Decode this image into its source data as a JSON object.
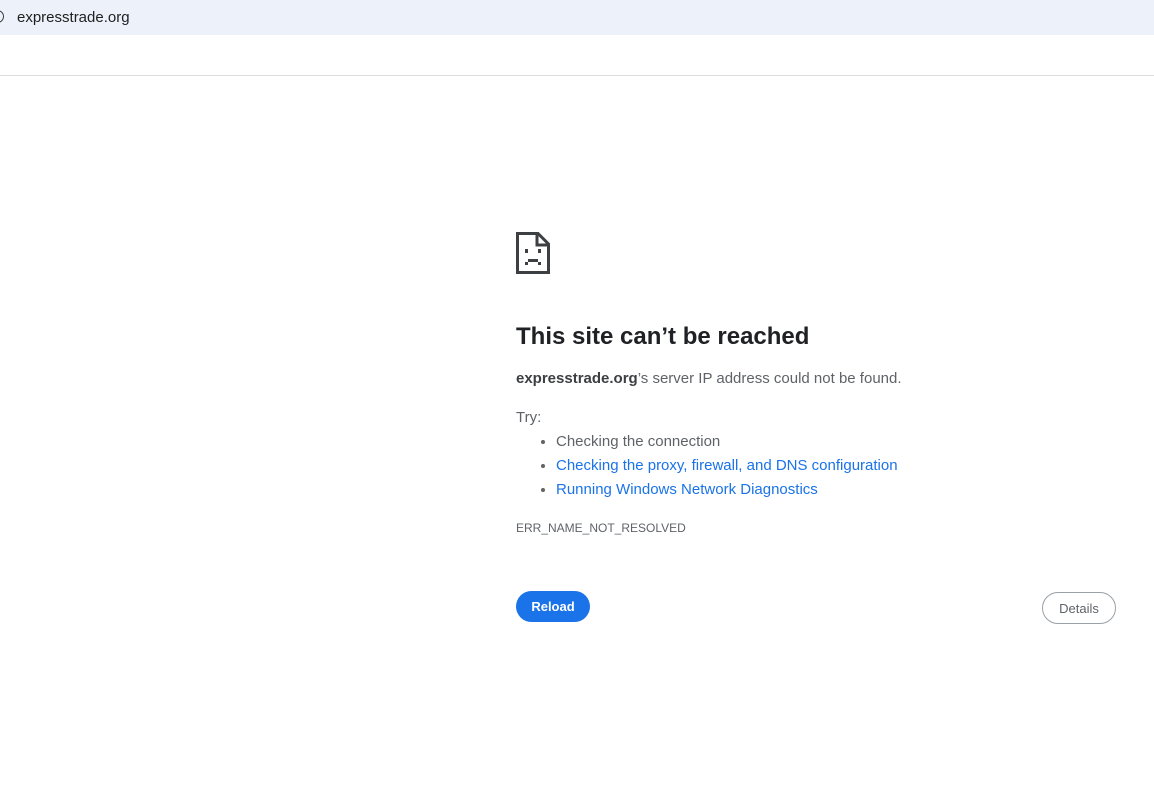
{
  "address_bar": {
    "url": "expresstrade.org",
    "icon": "site-info-icon"
  },
  "error": {
    "icon": "sad-page-icon",
    "title": "This site can’t be reached",
    "host": "expresstrade.org",
    "summary_suffix": "’s server IP address could not be found.",
    "try_label": "Try:",
    "suggestions": [
      {
        "label": "Checking the connection",
        "is_link": false
      },
      {
        "label": "Checking the proxy, firewall, and DNS configuration",
        "is_link": true
      },
      {
        "label": "Running Windows Network Diagnostics",
        "is_link": true
      }
    ],
    "code": "ERR_NAME_NOT_RESOLVED"
  },
  "buttons": {
    "reload_label": "Reload",
    "details_label": "Details"
  },
  "colors": {
    "accent": "#1a73e8",
    "text_primary": "#202124",
    "text_secondary": "#5f6368",
    "address_bar_bg": "#edf2fa"
  }
}
